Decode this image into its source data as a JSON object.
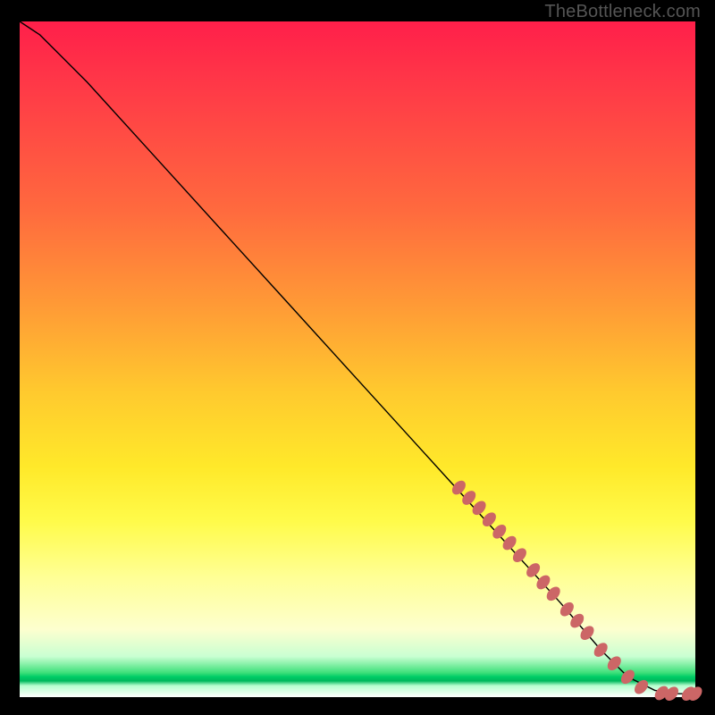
{
  "attribution": "TheBottleneck.com",
  "chart_data": {
    "type": "line",
    "title": "",
    "xlabel": "",
    "ylabel": "",
    "xlim": [
      0,
      100
    ],
    "ylim": [
      0,
      100
    ],
    "grid": false,
    "series": [
      {
        "name": "curve",
        "x": [
          0,
          3,
          6,
          10,
          20,
          30,
          40,
          50,
          60,
          70,
          80,
          86,
          90,
          94,
          97,
          100
        ],
        "y": [
          100,
          98,
          95,
          91,
          80,
          69,
          58,
          47,
          36,
          25,
          14,
          7,
          3,
          1,
          0.5,
          0.5
        ]
      }
    ],
    "markers": {
      "name": "highlighted-points",
      "color": "#cc6666",
      "points": [
        {
          "x": 65,
          "y": 31
        },
        {
          "x": 66.5,
          "y": 29.5
        },
        {
          "x": 68,
          "y": 28
        },
        {
          "x": 69.5,
          "y": 26.3
        },
        {
          "x": 71,
          "y": 24.5
        },
        {
          "x": 72.5,
          "y": 22.8
        },
        {
          "x": 74,
          "y": 21
        },
        {
          "x": 76,
          "y": 18.8
        },
        {
          "x": 77.5,
          "y": 17
        },
        {
          "x": 79,
          "y": 15.3
        },
        {
          "x": 81,
          "y": 13
        },
        {
          "x": 82.5,
          "y": 11.3
        },
        {
          "x": 84,
          "y": 9.5
        },
        {
          "x": 86,
          "y": 7
        },
        {
          "x": 88,
          "y": 5
        },
        {
          "x": 90,
          "y": 3
        },
        {
          "x": 92,
          "y": 1.5
        },
        {
          "x": 95,
          "y": 0.6
        },
        {
          "x": 96.5,
          "y": 0.5
        },
        {
          "x": 99,
          "y": 0.5
        },
        {
          "x": 100,
          "y": 0.5
        }
      ]
    }
  }
}
